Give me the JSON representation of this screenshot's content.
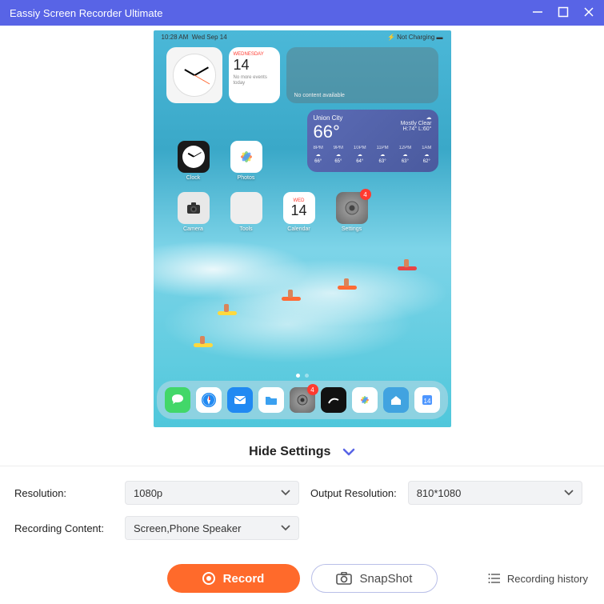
{
  "titlebar": {
    "title": "Eassiy Screen Recorder Ultimate"
  },
  "device": {
    "status": {
      "time": "10:28 AM",
      "date": "Wed Sep 14",
      "battery": "Not Charging"
    },
    "clock_widget": {},
    "calendar_widget": {
      "weekday": "WEDNESDAY",
      "day": "14",
      "sub": "No more events today"
    },
    "empty_widget": {
      "text": "No content available"
    },
    "weather": {
      "city": "Union City",
      "temp": "66°",
      "cond": "Mostly Clear",
      "range": "H:74° L:60°",
      "hours": [
        {
          "t": "8PM",
          "d": "66°"
        },
        {
          "t": "9PM",
          "d": "65°"
        },
        {
          "t": "10PM",
          "d": "64°"
        },
        {
          "t": "11PM",
          "d": "63°"
        },
        {
          "t": "12PM",
          "d": "63°"
        },
        {
          "t": "1AM",
          "d": "62°"
        }
      ]
    },
    "row1": [
      {
        "name": "clock",
        "label": "Clock"
      },
      {
        "name": "photos",
        "label": "Photos"
      }
    ],
    "row2": [
      {
        "name": "camera",
        "label": "Camera"
      },
      {
        "name": "tools",
        "label": "Tools"
      },
      {
        "name": "calendar",
        "label": "Calendar",
        "weekday": "WED",
        "day": "14"
      },
      {
        "name": "settings",
        "label": "Settings",
        "badge": "4"
      }
    ],
    "dock_badge": "4"
  },
  "toggle": {
    "label": "Hide Settings"
  },
  "settings": {
    "resolution_label": "Resolution:",
    "resolution_value": "1080p",
    "output_label": "Output Resolution:",
    "output_value": "810*1080",
    "content_label": "Recording Content:",
    "content_value": "Screen,Phone Speaker"
  },
  "actions": {
    "record": "Record",
    "snapshot": "SnapShot",
    "history": "Recording history"
  }
}
